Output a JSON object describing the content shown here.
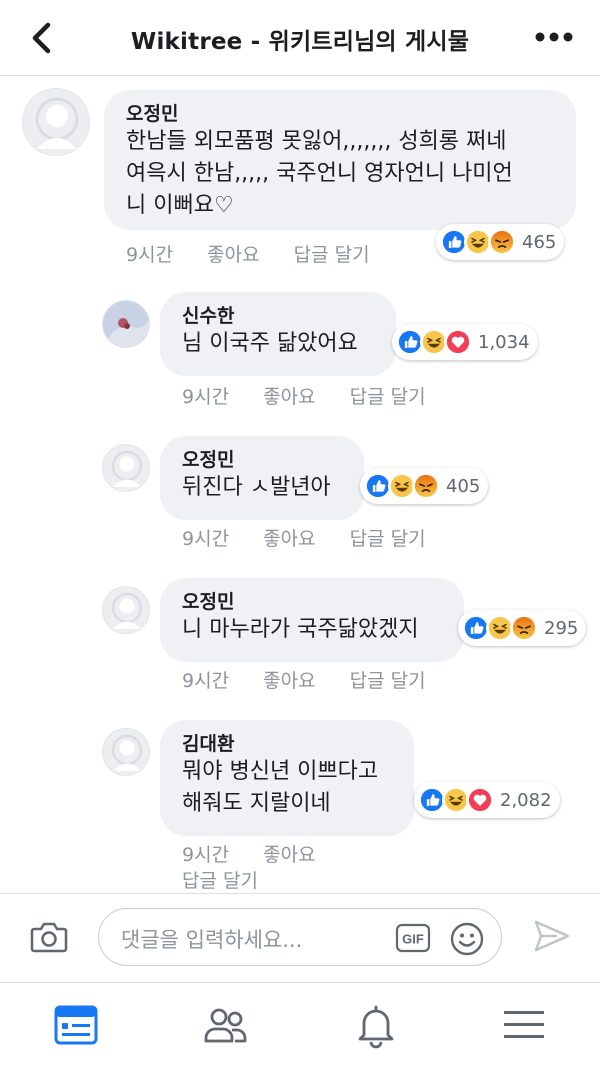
{
  "header": {
    "title": "Wikitree - 위키트리님의 게시물",
    "back_icon": "chevron-left-icon",
    "more_icon": "ellipsis-icon"
  },
  "colors": {
    "like_blue": "#1877f2",
    "haha_yellow": "#f7c64a",
    "angry_orange": "#e9710f",
    "love_red": "#f33e58",
    "meta_gray": "#8d949e",
    "bubble_bg": "#f0f1f4",
    "active_tab_blue": "#1877f2"
  },
  "comments": [
    {
      "author": "오정민",
      "text": "한남들 외모품평 못잃어,,,,,,, 성희롱 쩌네\n여윽시 한남,,,,, 국주언니 영자언니 나미언\n니 이뻐요♡",
      "time": "9시간",
      "like_label": "좋아요",
      "reply_label": "답글 달기",
      "reactions": [
        "like",
        "haha",
        "angry"
      ],
      "reaction_count": "465"
    },
    {
      "author": "신수한",
      "text": "님 이국주 닮았어요",
      "time": "9시간",
      "like_label": "좋아요",
      "reply_label": "답글 달기",
      "reactions": [
        "like",
        "haha",
        "love"
      ],
      "reaction_count": "1,034"
    },
    {
      "author": "오정민",
      "text": "뒤진다 ㅅ발년아",
      "time": "9시간",
      "like_label": "좋아요",
      "reply_label": "답글 달기",
      "reactions": [
        "like",
        "haha",
        "angry"
      ],
      "reaction_count": "405"
    },
    {
      "author": "오정민",
      "text": "니 마누라가 국주닮았겠지",
      "time": "9시간",
      "like_label": "좋아요",
      "reply_label": "답글 달기",
      "reactions": [
        "like",
        "haha",
        "angry"
      ],
      "reaction_count": "295"
    },
    {
      "author": "김대환",
      "text": "뭐야 병신년 이쁘다고\n해줘도 지랄이네",
      "time": "9시간",
      "like_label": "좋아요",
      "reply_label": "답글 달기",
      "reactions": [
        "like",
        "haha",
        "love"
      ],
      "reaction_count": "2,082"
    }
  ],
  "composer": {
    "placeholder": "댓글을 입력하세요...",
    "gif_label": "GIF",
    "camera_icon": "camera-icon",
    "emoji_icon": "smiley-icon",
    "send_icon": "send-icon"
  },
  "tabbar": {
    "items": [
      "news-feed-icon",
      "friends-icon",
      "notifications-icon",
      "menu-icon"
    ],
    "active": "news-feed-icon"
  }
}
